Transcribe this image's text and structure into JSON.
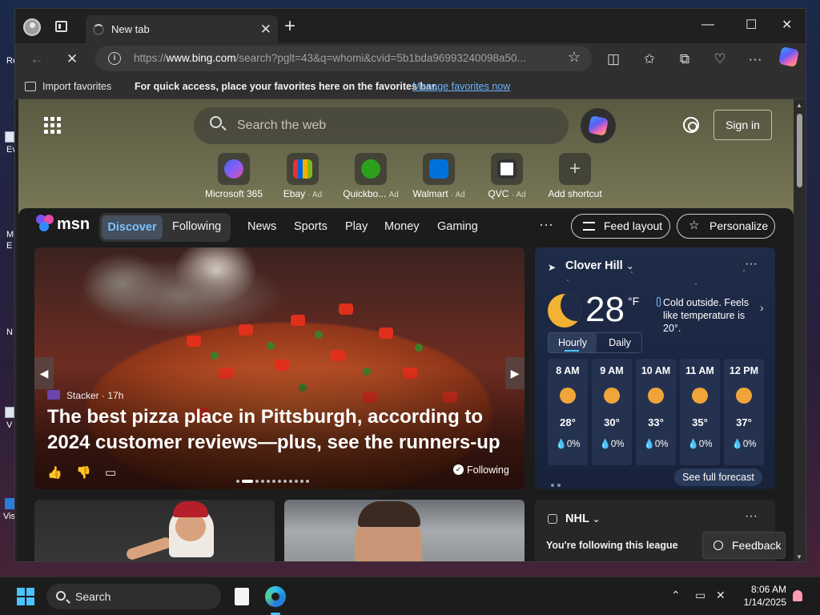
{
  "desktop": {
    "icons": [
      {
        "label": "Re"
      },
      {
        "label": "Ev"
      },
      {
        "label": "M E"
      },
      {
        "label": "N"
      },
      {
        "label": "V"
      },
      {
        "label": "Vis"
      }
    ]
  },
  "browser": {
    "tab": {
      "title": "New tab"
    },
    "address": {
      "scheme": "https://",
      "host": "www.bing.com",
      "path": "/search?pglt=43&q=whomi&cvid=5b1bda96993240098a50..."
    },
    "favorites_bar": {
      "import_label": "Import favorites",
      "message": "For quick access, place your favorites here on the favorites bar.",
      "manage_link": "Manage favorites now"
    }
  },
  "newtab": {
    "search_placeholder": "Search the web",
    "sign_in": "Sign in",
    "shortcuts": [
      {
        "label": "Microsoft 365",
        "ad": ""
      },
      {
        "label": "Ebay",
        "ad": "· Ad"
      },
      {
        "label": "Quickbo...",
        "ad": "Ad"
      },
      {
        "label": "Walmart",
        "ad": "· Ad"
      },
      {
        "label": "QVC",
        "ad": "· Ad"
      },
      {
        "label": "Add shortcut",
        "ad": ""
      }
    ]
  },
  "msn": {
    "logo_text": "msn",
    "tabs": {
      "discover": "Discover",
      "following": "Following"
    },
    "nav": [
      "News",
      "Sports",
      "Play",
      "Money",
      "Gaming"
    ],
    "more": "···",
    "feed_layout": "Feed layout",
    "personalize": "Personalize",
    "hero": {
      "source": "Stacker",
      "age": "· 17h",
      "headline": "The best pizza place in Pittsburgh, according to 2024 customer reviews—plus, see the runners-up",
      "following": "Following"
    },
    "weather": {
      "location": "Clover Hill",
      "temperature": "28",
      "unit": "°F",
      "description": "Cold outside. Feels like temperature is 20°.",
      "toggle_hourly": "Hourly",
      "toggle_daily": "Daily",
      "hours": [
        {
          "time": "8 AM",
          "temp": "28°",
          "precip": "💧0%"
        },
        {
          "time": "9 AM",
          "temp": "30°",
          "precip": "💧0%"
        },
        {
          "time": "10 AM",
          "temp": "33°",
          "precip": "💧0%"
        },
        {
          "time": "11 AM",
          "temp": "35°",
          "precip": "💧0%"
        },
        {
          "time": "12 PM",
          "temp": "37°",
          "precip": "💧0%"
        }
      ],
      "see_forecast": "See full forecast"
    },
    "nhl": {
      "title": "NHL",
      "subtitle": "You're following this league"
    },
    "feedback": "Feedback"
  },
  "taskbar": {
    "search": "Search",
    "time": "8:06 AM",
    "date": "1/14/2025"
  }
}
